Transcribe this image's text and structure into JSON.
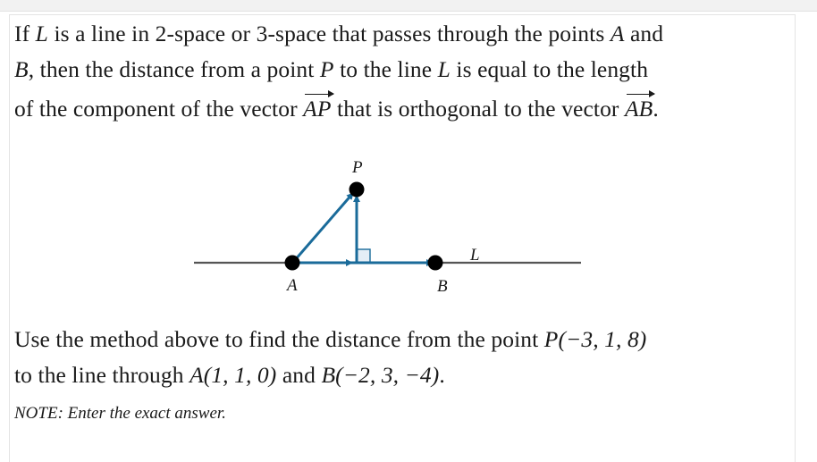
{
  "intro": {
    "line1_a": "If ",
    "L": "L",
    "line1_b": " is a line in 2-space or 3-space that passes through the points ",
    "A": "A",
    "line1_c": " and",
    "B": "B",
    "line2_a": ", then the distance from a point ",
    "P": "P",
    "line2_b": " to the line ",
    "line2_c": " is equal to the length",
    "line3_a": "of the component of the vector ",
    "vec_AP": "AP",
    "line3_b": " that is orthogonal to the vector ",
    "vec_AB": "AB",
    "line3_c": "."
  },
  "figure": {
    "label_P": "P",
    "label_A": "A",
    "label_B": "B",
    "label_L": "L",
    "vector_color": "#1a6b9a",
    "line_color": "#555555",
    "right_angle_fill": "#e4eef6"
  },
  "question": {
    "line1": "Use the method above to find the distance from the point ",
    "point_P": "P(−3, 1, 8)",
    "line2_a": "to the line through ",
    "point_A": "A(1, 1, 0)",
    "line2_b": " and ",
    "point_B": "B(−2, 3, −4)",
    "line2_c": "."
  },
  "note": "NOTE: Enter the exact answer."
}
